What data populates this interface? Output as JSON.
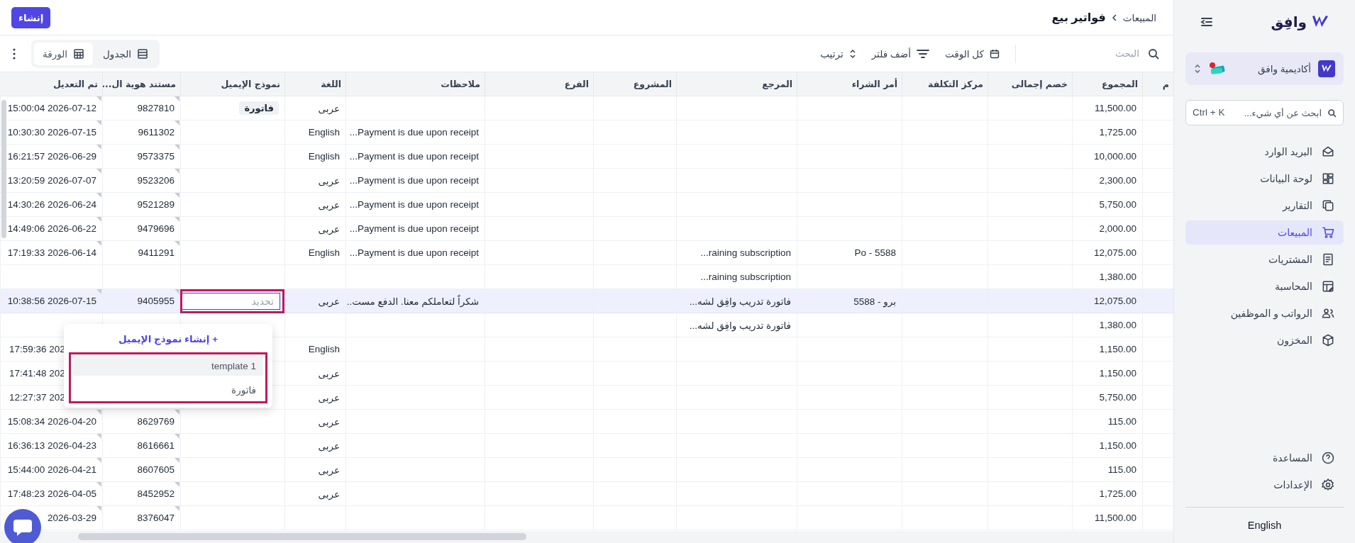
{
  "header": {
    "breadcrumb_parent": "المبيعات",
    "title": "فواتير بيع",
    "create_button": "إنشاء"
  },
  "toolbar": {
    "search": {
      "placeholder": "البحث"
    },
    "time_filter": "كل الوقت",
    "add_filter": "أضف فلتر",
    "sort": "ترتيب",
    "views": [
      {
        "label": "الجدول",
        "selected": false
      },
      {
        "label": "الورقة",
        "selected": true
      }
    ]
  },
  "table": {
    "columns": [
      "م",
      "المجموع",
      "خصم إجمالى",
      "مركز التكلفة",
      "أمر الشراء",
      "المرجع",
      "المشروع",
      "الفرع",
      "ملاحظات",
      "اللغة",
      "نموذج الإيميل",
      "مستند هوية ال...",
      "تم التعديل"
    ],
    "rows": [
      {
        "selected": false,
        "modified": "15:00:04 2026-07-12",
        "doc_id": "9827810",
        "template_tag": "فاتورة",
        "language": "عربى",
        "total": "11,500.00"
      },
      {
        "selected": false,
        "modified": "10:30:30 2026-07-15",
        "doc_id": "9611302",
        "language": "English",
        "notes": "Payment is due upon receipt...",
        "total": "1,725.00"
      },
      {
        "selected": false,
        "modified": "16:21:57 2026-06-29",
        "doc_id": "9573375",
        "language": "English",
        "notes": "Payment is due upon receipt...",
        "total": "10,000.00"
      },
      {
        "selected": false,
        "modified": "13:20:59 2026-07-07",
        "doc_id": "9523206",
        "language": "عربى",
        "notes": "Payment is due upon receipt...",
        "total": "2,300.00"
      },
      {
        "selected": false,
        "modified": "14:30:26 2026-06-24",
        "doc_id": "9521289",
        "language": "عربى",
        "notes": "Payment is due upon receipt...",
        "total": "5,750.00"
      },
      {
        "selected": false,
        "modified": "14:49:06 2026-06-22",
        "doc_id": "9479696",
        "language": "عربى",
        "notes": "Payment is due upon receipt...",
        "total": "2,000.00"
      },
      {
        "selected": false,
        "modified": "17:19:33 2026-06-14",
        "doc_id": "9411291",
        "language": "English",
        "notes": "Payment is due upon receipt...",
        "reference": "raining subscription...",
        "purchase_order": "Po - 5588",
        "total": "12,075.00"
      },
      {
        "selected": false,
        "reference": "raining subscription...",
        "total": "1,380.00"
      },
      {
        "selected": true,
        "modified": "10:38:56 2026-07-15",
        "doc_id": "9405955",
        "template_editor": {
          "placeholder": "تحديد"
        },
        "language": "عربى",
        "notes": "شكراً لتعاملكم معنا. الدفع مست...",
        "reference": "فاتورة تدريب وافِق لشه...",
        "purchase_order": "برو - 5588",
        "total": "12,075.00"
      },
      {
        "selected": false,
        "reference": "فاتورة تدريب وافِق لشه...",
        "total": "1,380.00"
      },
      {
        "selected": false,
        "modified": "17:59:36 202",
        "language": "English",
        "total": "1,150.00"
      },
      {
        "selected": false,
        "modified": "17:41:48 202",
        "language": "عربى",
        "total": "1,150.00"
      },
      {
        "selected": false,
        "modified": "12:27:37 202",
        "language": "عربى",
        "total": "5,750.00"
      },
      {
        "selected": false,
        "modified": "15:08:34 2026-04-20",
        "doc_id": "8629769",
        "language": "عربى",
        "total": "115.00"
      },
      {
        "selected": false,
        "modified": "16:36:13 2026-04-23",
        "doc_id": "8616661",
        "language": "عربى",
        "total": "1,150.00"
      },
      {
        "selected": false,
        "modified": "15:44:00 2026-04-21",
        "doc_id": "8607605",
        "language": "عربى",
        "total": "115.00"
      },
      {
        "selected": false,
        "modified": "17:48:23 2026-04-05",
        "doc_id": "8452952",
        "language": "عربى",
        "total": "1,725.00"
      },
      {
        "selected": false,
        "modified": "2026-03-29",
        "doc_id": "8376047",
        "total": "11,500.00"
      }
    ]
  },
  "template_dropdown": {
    "create_label": "+ إنشاء نموذج الإيميل",
    "options": [
      {
        "label": "template 1",
        "highlighted": true
      },
      {
        "label": "فاتورة",
        "highlighted": false
      }
    ]
  },
  "sidebar": {
    "logo": "وافِق",
    "organization": "أكاديمية وافق",
    "search": {
      "placeholder": "ابحث عن أي شيء...",
      "shortcut": "Ctrl + K"
    },
    "items": [
      {
        "label": "البريد الوارد",
        "selected": false
      },
      {
        "label": "لوحة البيانات",
        "selected": false
      },
      {
        "label": "التقارير",
        "selected": false
      },
      {
        "label": "المبيعات",
        "selected": true
      },
      {
        "label": "المشتريات",
        "selected": false
      },
      {
        "label": "المحاسبة",
        "selected": false
      },
      {
        "label": "الرواتب و الموظفين",
        "selected": false
      },
      {
        "label": "المخزون",
        "selected": false
      }
    ],
    "bottom_items": [
      {
        "label": "المساعدة"
      },
      {
        "label": "الإعدادات"
      }
    ],
    "language": "English"
  }
}
